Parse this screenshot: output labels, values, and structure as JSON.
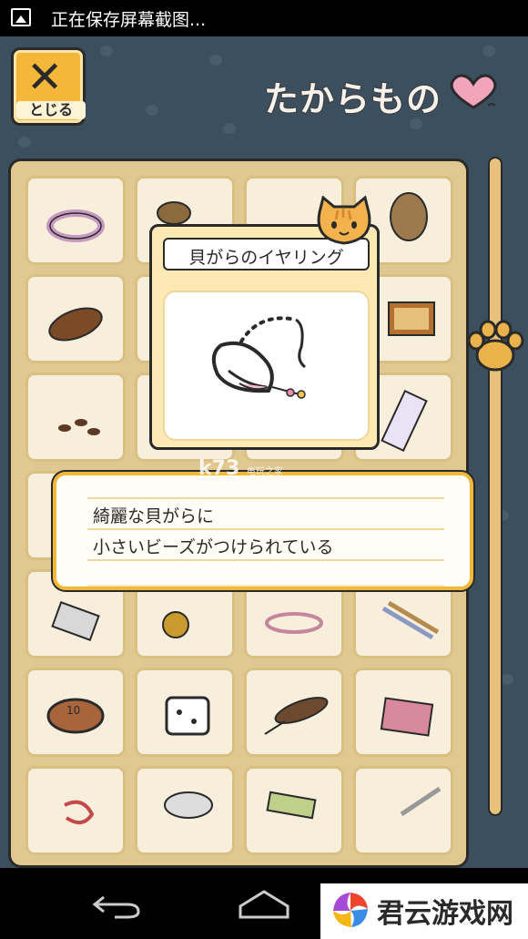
{
  "status_bar": {
    "text": "正在保存屏幕截图..."
  },
  "header": {
    "close_label": "とじる",
    "title": "たからもの"
  },
  "popup": {
    "item_name": "貝がらのイヤリング"
  },
  "description": {
    "line1": "綺麗な貝がらに",
    "line2": "小さいビーズがつけられている"
  },
  "watermark": {
    "main": "k73",
    "sub": "电玩之家"
  },
  "brand": {
    "text": "君云游戏网"
  },
  "colors": {
    "background": "#3c4f5f",
    "frame": "#e0c890",
    "accent": "#f2b83a"
  }
}
